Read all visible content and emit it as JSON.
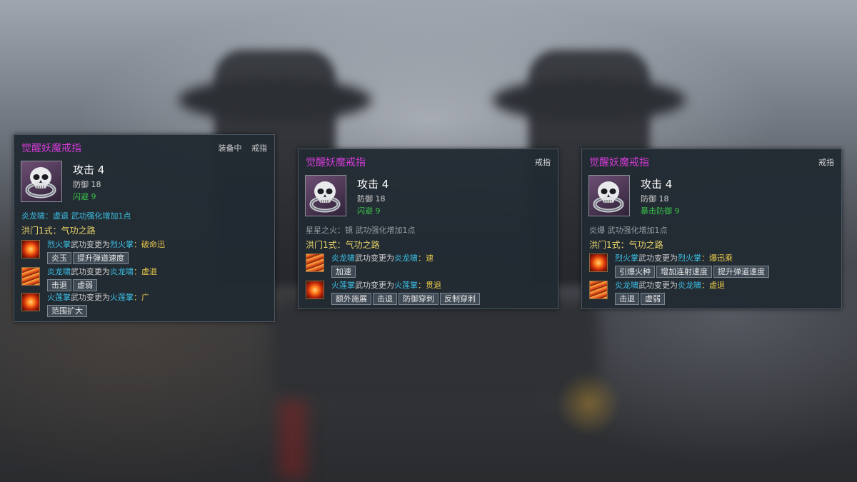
{
  "cards": [
    {
      "title": "觉醒妖魔戒指",
      "status": "装备中",
      "slot": "戒指",
      "attack": "攻击 4",
      "defense": "防御 18",
      "bonus": "闪避 9",
      "enhance": "炎龙啸：虚退 武功强化增加1点",
      "path": "洪门1式：气功之路",
      "skills": [
        {
          "name": "烈火掌",
          "mid": "武功变更为",
          "to": "烈火掌",
          "sep": "：",
          "effect": "破命迅",
          "tags": [
            "炎玉",
            "提升弹道速度"
          ],
          "icon": "fire"
        },
        {
          "name": "炎龙啸",
          "mid": "武功变更为",
          "to": "炎龙啸",
          "sep": "：",
          "effect": "虚退",
          "tags": [
            "击退",
            "虚弱"
          ],
          "icon": "dragon"
        },
        {
          "name": "火莲掌",
          "mid": "武功变更为",
          "to": "火莲掌",
          "sep": "：",
          "effect": "广",
          "tags": [
            "范围扩大"
          ],
          "icon": "fire"
        }
      ]
    },
    {
      "title": "觉醒妖魔戒指",
      "slot": "戒指",
      "attack": "攻击 4",
      "defense": "防御 18",
      "bonus": "闪避 9",
      "enhance": "星星之火：镜 武功强化增加1点",
      "path": "洪门1式：气功之路",
      "skills": [
        {
          "name": "炎龙啸",
          "mid": "武功变更为",
          "to": "炎龙啸",
          "sep": "：",
          "effect": "速",
          "tags": [
            "加速"
          ],
          "icon": "dragon"
        },
        {
          "name": "火莲掌",
          "mid": "武功变更为",
          "to": "火莲掌",
          "sep": "：",
          "effect": "贯退",
          "tags": [
            "额外施展",
            "击退",
            "防御穿刺",
            "反制穿刺"
          ],
          "icon": "fire"
        }
      ]
    },
    {
      "title": "觉醒妖魔戒指",
      "slot": "戒指",
      "attack": "攻击 4",
      "defense": "防御 18",
      "bonus": "暴击防御 9",
      "enhance": "炎爆 武功强化增加1点",
      "path": "洪门1式：气功之路",
      "skills": [
        {
          "name": "烈火掌",
          "mid": "武功变更为",
          "to": "烈火掌",
          "sep": "：",
          "effect": "爆迅乘",
          "tags": [
            "引爆火种",
            "增加连射速度",
            "提升弹道速度"
          ],
          "icon": "fire"
        },
        {
          "name": "炎龙啸",
          "mid": "武功变更为",
          "to": "炎龙啸",
          "sep": "：",
          "effect": "虚退",
          "tags": [
            "击退",
            "虚弱"
          ],
          "icon": "dragon"
        }
      ]
    }
  ]
}
